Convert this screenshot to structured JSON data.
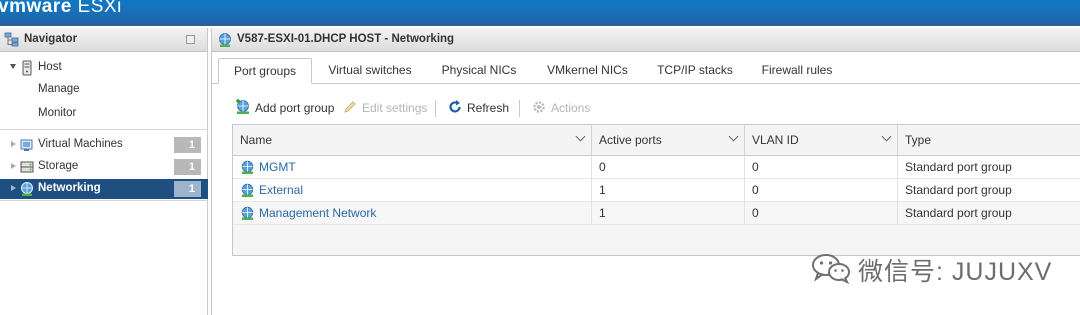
{
  "header": {
    "brand_vm": "vmware",
    "brand_product": "ESXi"
  },
  "navigator": {
    "title": "Navigator",
    "host": {
      "label": "Host",
      "children": [
        "Manage",
        "Monitor"
      ]
    },
    "items": [
      {
        "label": "Virtual Machines",
        "count": "1"
      },
      {
        "label": "Storage",
        "count": "1"
      },
      {
        "label": "Networking",
        "count": "1",
        "active": true
      }
    ]
  },
  "panel": {
    "title": "V587-ESXI-01.DHCP HOST - Networking"
  },
  "tabs": [
    "Port groups",
    "Virtual switches",
    "Physical NICs",
    "VMkernel NICs",
    "TCP/IP stacks",
    "Firewall rules"
  ],
  "toolbar": {
    "add": "Add port group",
    "edit": "Edit settings",
    "refresh": "Refresh",
    "actions": "Actions"
  },
  "table": {
    "columns": [
      "Name",
      "Active ports",
      "VLAN ID",
      "Type"
    ],
    "rows": [
      [
        "MGMT",
        "0",
        "0",
        "Standard port group"
      ],
      [
        "External",
        "1",
        "0",
        "Standard port group"
      ],
      [
        "Management Network",
        "1",
        "0",
        "Standard port group"
      ]
    ]
  },
  "watermark": {
    "text": "微信号: JUJUXV"
  },
  "colors": {
    "header_blue": "#1c6ab0",
    "nav_active": "#1e4f80",
    "link": "#2a68a6"
  }
}
